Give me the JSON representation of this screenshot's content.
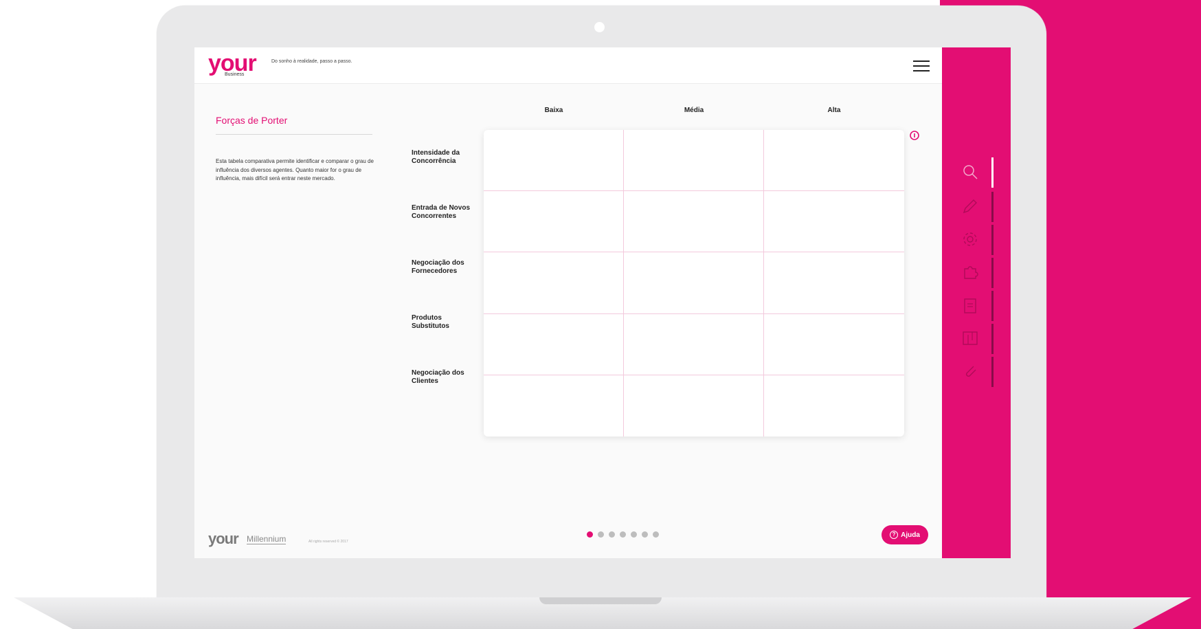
{
  "brand": {
    "logo_word": "your",
    "logo_sub": "Business",
    "tagline": "Do sonho à realidade, passo a passo."
  },
  "page": {
    "title": "Forças de Porter",
    "description": "Esta tabela comparativa permite identificar e comparar o grau de influência dos diversos agentes. Quanto maior for o grau de influência, mais difícil será entrar neste mercado."
  },
  "table": {
    "columns": [
      "Baixa",
      "Média",
      "Alta"
    ],
    "rows": [
      "Intensidade da Concorrência",
      "Entrada de Novos Concorrentes",
      "Negociação dos Fornecedores",
      "Produtos Substitutos",
      "Negociação dos Clientes"
    ]
  },
  "pagination": {
    "total": 7,
    "current": 1
  },
  "help_button": {
    "label": "Ajuda",
    "icon": "question-circle-icon"
  },
  "footer": {
    "logo_word": "your",
    "partner": "Millennium",
    "copyright": "All rights reserved © 2017"
  },
  "sidebar": {
    "items": [
      {
        "icon": "search-icon",
        "active": true
      },
      {
        "icon": "pencil-icon",
        "active": false
      },
      {
        "icon": "gear-icon",
        "active": false
      },
      {
        "icon": "puzzle-icon",
        "active": false
      },
      {
        "icon": "clipboard-icon",
        "active": false
      },
      {
        "icon": "chart-icon",
        "active": false
      },
      {
        "icon": "paperclip-icon",
        "active": false
      }
    ]
  },
  "colors": {
    "accent": "#e30e73",
    "grid_line": "#f3c9dc"
  }
}
